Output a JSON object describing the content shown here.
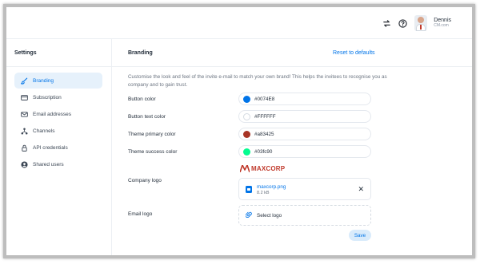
{
  "user": {
    "name": "Dennis",
    "org": "CM.com"
  },
  "sidebar": {
    "title": "Settings",
    "items": [
      {
        "label": "Branding",
        "icon": "brush-icon",
        "active": true
      },
      {
        "label": "Subscription",
        "icon": "card-icon",
        "active": false
      },
      {
        "label": "Email addresses",
        "icon": "envelope-icon",
        "active": false
      },
      {
        "label": "Channels",
        "icon": "channels-icon",
        "active": false
      },
      {
        "label": "API credentials",
        "icon": "lock-icon",
        "active": false
      },
      {
        "label": "Shared users",
        "icon": "user-circle-icon",
        "active": false
      }
    ]
  },
  "main": {
    "title": "Branding",
    "reset_label": "Reset to defaults",
    "description": "Customise the look and feel of the invite e-mail to match your own brand! This helps the invitees to recognise you as company and to gain trust.",
    "colors": [
      {
        "label": "Button color",
        "value": "#0074E8",
        "swatch": "#0074e8"
      },
      {
        "label": "Button text color",
        "value": "#FFFFFF",
        "swatch": "#ffffff"
      },
      {
        "label": "Theme primary color",
        "value": "#a83425",
        "swatch": "#a83425"
      },
      {
        "label": "Theme success color",
        "value": "#03fc90",
        "swatch": "#03fc90"
      }
    ],
    "company_logo": {
      "label": "Company logo",
      "brand_text": "MAXCORP",
      "file_name": "maxcorp.png",
      "file_size": "8.2 kB"
    },
    "email_logo": {
      "label": "Email logo",
      "select_label": "Select logo"
    },
    "save_label": "Save"
  },
  "colors": {
    "accent": "#0074e8",
    "brand": "#c0392b"
  }
}
